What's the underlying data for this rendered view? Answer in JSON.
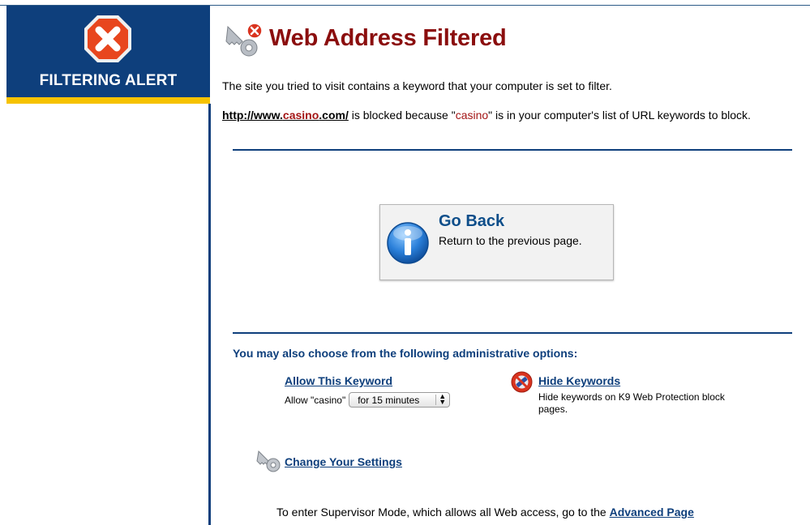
{
  "sidebar": {
    "title": "FILTERING ALERT",
    "icon": "close-x-icon"
  },
  "header": {
    "title": "Web Address Filtered",
    "icon": "blocked-keys-icon"
  },
  "message": {
    "intro": "The site you tried to visit contains a keyword that your computer is set to filter.",
    "url_prefix": "http://www.",
    "url_keyword": "casino",
    "url_suffix": ".com/",
    "blocked_text_1": " is blocked because \"",
    "keyword": "casino",
    "blocked_text_2": "\" is in your computer's list of URL keywords to block."
  },
  "go_back": {
    "title": "Go Back",
    "subtitle": "Return to the previous page.",
    "icon": "info-icon"
  },
  "admin": {
    "heading": "You may also choose from the following administrative options:",
    "allow_keyword": {
      "link": "Allow This Keyword",
      "label": "Allow \"casino\"",
      "selected_duration": "for 15 minutes"
    },
    "hide_keywords": {
      "link": "Hide Keywords",
      "description": "Hide keywords on K9 Web Protection block pages.",
      "icon": "no-entry-icon"
    },
    "change_settings": {
      "link": "Change Your Settings",
      "icon": "key-icon"
    },
    "supervisor": {
      "text": "To enter Supervisor Mode, which allows all Web access, go to the ",
      "link": "Advanced Page"
    }
  },
  "colors": {
    "brand_blue": "#0e3f7c",
    "accent_yellow": "#f6c200",
    "title_red": "#8b0e0e",
    "keyword_red": "#a31515"
  }
}
